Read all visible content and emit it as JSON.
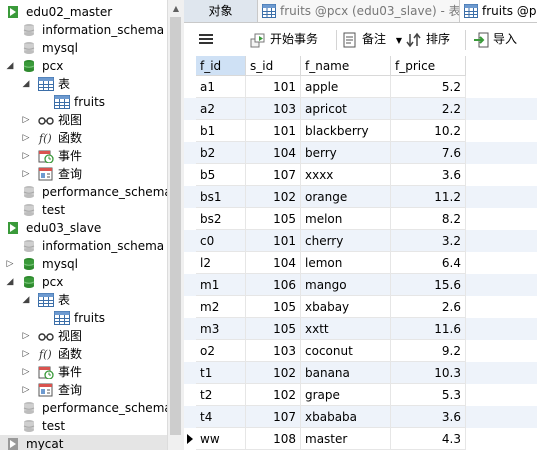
{
  "tree": [
    {
      "label": "edu02_master",
      "icon": "connection-icon",
      "level": 0,
      "twisty": "expanded"
    },
    {
      "label": "information_schema",
      "icon": "database-icon",
      "level": 1,
      "twisty": "none"
    },
    {
      "label": "mysql",
      "icon": "database-icon",
      "level": 1,
      "twisty": "none"
    },
    {
      "label": "pcx",
      "icon": "database-open-icon",
      "level": 1,
      "twisty": "expanded"
    },
    {
      "label": "表",
      "icon": "table-group-icon",
      "level": 2,
      "twisty": "expanded"
    },
    {
      "label": "fruits",
      "icon": "table-icon",
      "level": 3,
      "twisty": "none"
    },
    {
      "label": "视图",
      "icon": "view-icon",
      "level": 2,
      "twisty": "collapsed"
    },
    {
      "label": "函数",
      "icon": "function-icon",
      "level": 2,
      "twisty": "collapsed"
    },
    {
      "label": "事件",
      "icon": "event-icon",
      "level": 2,
      "twisty": "collapsed"
    },
    {
      "label": "查询",
      "icon": "query-icon",
      "level": 2,
      "twisty": "collapsed"
    },
    {
      "label": "performance_schema",
      "icon": "database-icon",
      "level": 1,
      "twisty": "none"
    },
    {
      "label": "test",
      "icon": "database-icon",
      "level": 1,
      "twisty": "none"
    },
    {
      "label": "edu03_slave",
      "icon": "connection-icon",
      "level": 0,
      "twisty": "expanded"
    },
    {
      "label": "information_schema",
      "icon": "database-icon",
      "level": 1,
      "twisty": "none"
    },
    {
      "label": "mysql",
      "icon": "database-open-icon",
      "level": 1,
      "twisty": "collapsed"
    },
    {
      "label": "pcx",
      "icon": "database-open-icon",
      "level": 1,
      "twisty": "expanded"
    },
    {
      "label": "表",
      "icon": "table-group-icon",
      "level": 2,
      "twisty": "expanded"
    },
    {
      "label": "fruits",
      "icon": "table-icon",
      "level": 3,
      "twisty": "none"
    },
    {
      "label": "视图",
      "icon": "view-icon",
      "level": 2,
      "twisty": "collapsed"
    },
    {
      "label": "函数",
      "icon": "function-icon",
      "level": 2,
      "twisty": "collapsed"
    },
    {
      "label": "事件",
      "icon": "event-icon",
      "level": 2,
      "twisty": "collapsed"
    },
    {
      "label": "查询",
      "icon": "query-icon",
      "level": 2,
      "twisty": "collapsed"
    },
    {
      "label": "performance_schema",
      "icon": "database-icon",
      "level": 1,
      "twisty": "none"
    },
    {
      "label": "test",
      "icon": "database-icon",
      "level": 1,
      "twisty": "none"
    },
    {
      "label": "mycat",
      "icon": "connection-grey-icon",
      "level": 0,
      "twisty": "none",
      "selected": true
    }
  ],
  "tabs": {
    "objects": "对象",
    "tab1": "fruits @pcx (edu03_slave) - 表",
    "tab2": "fruits @pc"
  },
  "toolbar": {
    "menu_icon": "hamburger-icon",
    "begin_transaction": "开始事务",
    "note": "备注",
    "sort": "排序",
    "import": "导入"
  },
  "columns": [
    "f_id",
    "s_id",
    "f_name",
    "f_price"
  ],
  "selected_column": "f_id",
  "rows": [
    [
      "a1",
      "101",
      "apple",
      "5.2"
    ],
    [
      "a2",
      "103",
      "apricot",
      "2.2"
    ],
    [
      "b1",
      "101",
      "blackberry",
      "10.2"
    ],
    [
      "b2",
      "104",
      "berry",
      "7.6"
    ],
    [
      "b5",
      "107",
      "xxxx",
      "3.6"
    ],
    [
      "bs1",
      "102",
      "orange",
      "11.2"
    ],
    [
      "bs2",
      "105",
      "melon",
      "8.2"
    ],
    [
      "c0",
      "101",
      "cherry",
      "3.2"
    ],
    [
      "l2",
      "104",
      "lemon",
      "6.4"
    ],
    [
      "m1",
      "106",
      "mango",
      "15.6"
    ],
    [
      "m2",
      "105",
      "xbabay",
      "2.6"
    ],
    [
      "m3",
      "105",
      "xxtt",
      "11.6"
    ],
    [
      "o2",
      "103",
      "coconut",
      "9.2"
    ],
    [
      "t1",
      "102",
      "banana",
      "10.3"
    ],
    [
      "t2",
      "102",
      "grape",
      "5.3"
    ],
    [
      "t4",
      "107",
      "xbababa",
      "3.6"
    ],
    [
      "ww",
      "108",
      "master",
      "4.3"
    ]
  ],
  "current_row_index": 16,
  "colors": {
    "accent_green": "#3a9a3a",
    "selection_blue": "#cfe1f5",
    "alt_row": "#eef3fa"
  }
}
